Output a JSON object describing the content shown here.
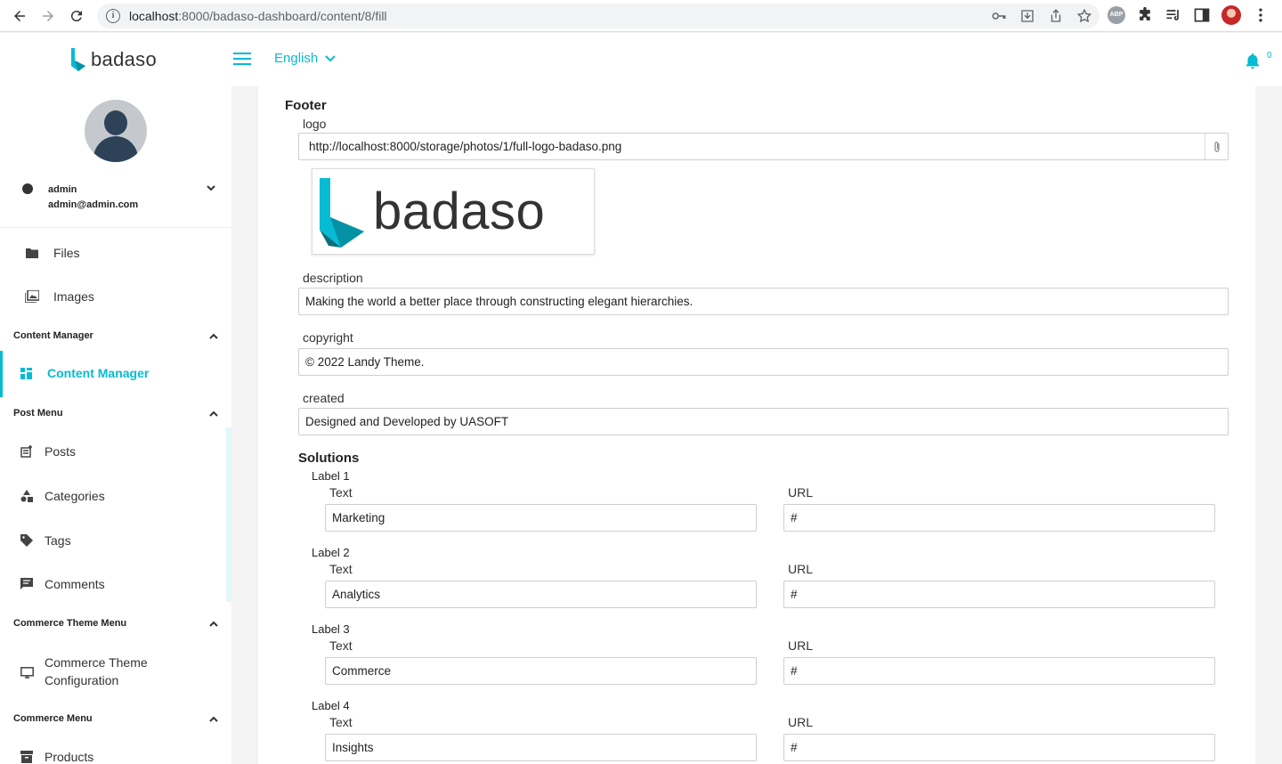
{
  "browser": {
    "url_host": "localhost",
    "url_path": ":8000/badaso-dashboard/content/8/fill"
  },
  "header": {
    "logo_text": "badaso",
    "language": "English",
    "notification_count": "0"
  },
  "sidebar": {
    "user_name": "admin",
    "user_email": "admin@admin.com",
    "items": [
      {
        "label": "Files"
      },
      {
        "label": "Images"
      }
    ],
    "groups": [
      {
        "label": "Content Manager"
      },
      {
        "label": "Post Menu"
      },
      {
        "label": "Commerce Theme Menu"
      },
      {
        "label": "Commerce Menu"
      }
    ],
    "active_item": "Content Manager",
    "post_items": [
      {
        "label": "Posts"
      },
      {
        "label": "Categories"
      },
      {
        "label": "Tags"
      },
      {
        "label": "Comments"
      }
    ],
    "commerce_theme_item_line1": "Commerce Theme",
    "commerce_theme_item_line2": "Configuration",
    "commerce_items": [
      {
        "label": "Products"
      }
    ]
  },
  "content": {
    "footer_title": "Footer",
    "logo_label": "logo",
    "logo_value": "http://localhost:8000/storage/photos/1/full-logo-badaso.png",
    "logo_preview_text": "badaso",
    "description_label": "description",
    "description_value": "Making the world a better place through constructing elegant hierarchies.",
    "copyright_label": "copyright",
    "copyright_value": "© 2022 Landy Theme.",
    "created_label": "created",
    "created_value": "Designed and Developed by UASOFT",
    "solutions_title": "Solutions",
    "text_label": "Text",
    "url_label": "URL",
    "solutions": [
      {
        "label": "Label 1",
        "text": "Marketing",
        "url": "#"
      },
      {
        "label": "Label 2",
        "text": "Analytics",
        "url": "#"
      },
      {
        "label": "Label 3",
        "text": "Commerce",
        "url": "#"
      },
      {
        "label": "Label 4",
        "text": "Insights",
        "url": "#"
      }
    ]
  },
  "colors": {
    "accent": "#06bbd3",
    "logo_dark": "#333333",
    "avatar_bg": "#c5c9ce",
    "avatar_fg": "#2d4257"
  },
  "icons": [
    "back-icon",
    "forward-icon",
    "reload-icon",
    "info-icon",
    "key-icon",
    "download-icon",
    "share-icon",
    "star-icon",
    "adblock-icon",
    "puzzle-icon",
    "playlist-icon",
    "sidepanel-icon",
    "menu-dots-icon",
    "hamburger-icon",
    "chevron-down-icon",
    "bell-icon",
    "folder-icon",
    "image-icon",
    "dashboard-icon",
    "post-icon",
    "categories-icon",
    "tag-icon",
    "comment-icon",
    "monitor-icon",
    "box-icon",
    "paperclip-icon",
    "account-icon",
    "chevron-up-icon"
  ]
}
